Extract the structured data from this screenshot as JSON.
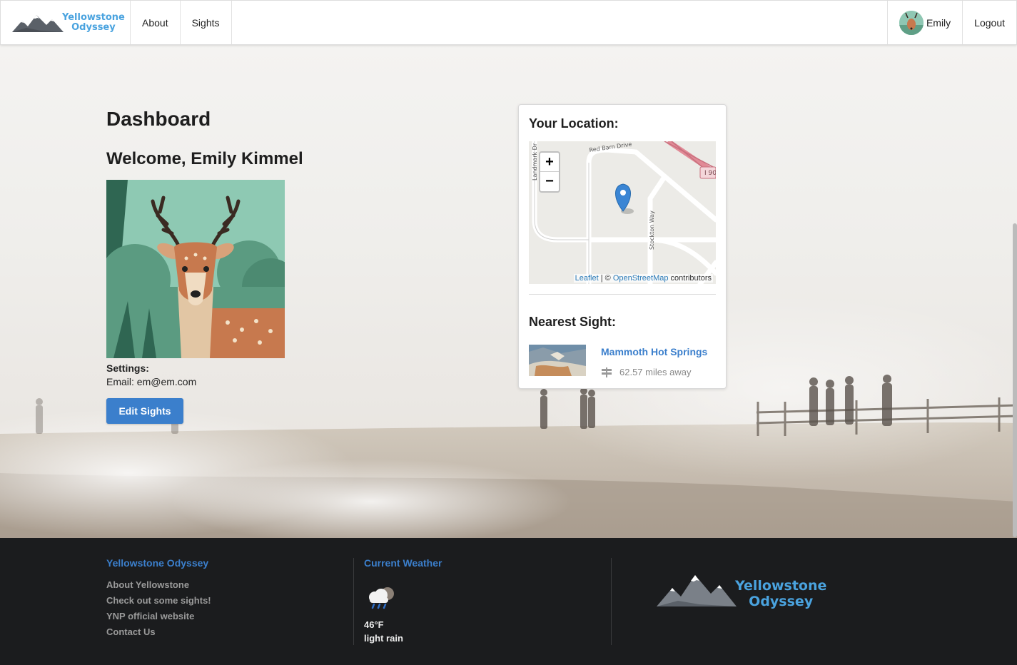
{
  "nav": {
    "brand_line1": "Yellowstone",
    "brand_line2": "Odyssey",
    "about": "About",
    "sights": "Sights",
    "user": "Emily",
    "logout": "Logout"
  },
  "dashboard": {
    "title": "Dashboard",
    "welcome": "Welcome, Emily Kimmel",
    "settings_label": "Settings:",
    "email": "Email: em@em.com",
    "edit_button": "Edit Sights"
  },
  "location_card": {
    "title": "Your Location:",
    "zoom_in": "+",
    "zoom_out": "−",
    "streets": [
      "Red Barn Drive",
      "Landmark Dr",
      "Stockton Way",
      "I 90"
    ],
    "attribution_leaflet": "Leaflet",
    "attribution_sep": " | © ",
    "attribution_osm": "OpenStreetMap",
    "attribution_tail": " contributors",
    "nearest_title": "Nearest Sight:",
    "nearest_name": "Mammoth Hot Springs",
    "nearest_distance": "62.57 miles away"
  },
  "footer": {
    "col1_title": "Yellowstone Odyssey",
    "links": [
      "About Yellowstone",
      "Check out some sights!",
      "YNP official website",
      "Contact Us"
    ],
    "col2_title": "Current Weather",
    "temperature": "46°F",
    "condition": "light rain",
    "logo_line1": "Yellowstone",
    "logo_line2": "Odyssey"
  },
  "colors": {
    "accent": "#3b7fcc",
    "brand": "#4aa3df",
    "footer_bg": "#1b1c1e"
  }
}
